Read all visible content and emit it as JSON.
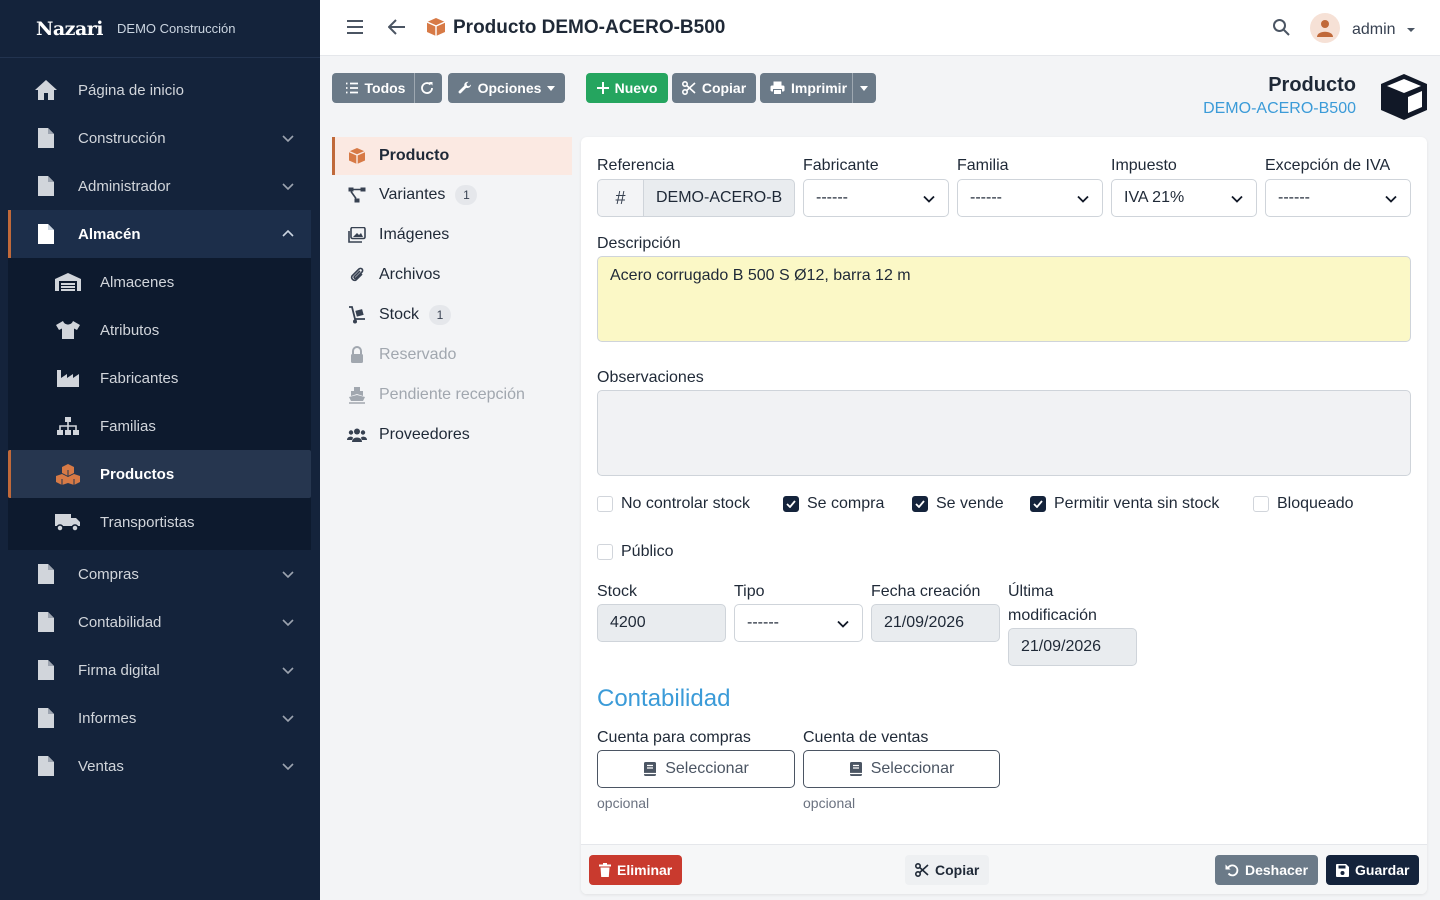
{
  "sidebar": {
    "brand": "Nazari",
    "company": "DEMO Construcción",
    "items": [
      {
        "label": "Página de inicio"
      },
      {
        "label": "Construcción"
      },
      {
        "label": "Administrador"
      },
      {
        "label": "Almacén"
      },
      {
        "label": "Compras"
      },
      {
        "label": "Contabilidad"
      },
      {
        "label": "Firma digital"
      },
      {
        "label": "Informes"
      },
      {
        "label": "Ventas"
      }
    ],
    "almacen_sub": [
      {
        "label": "Almacenes"
      },
      {
        "label": "Atributos"
      },
      {
        "label": "Fabricantes"
      },
      {
        "label": "Familias"
      },
      {
        "label": "Productos"
      },
      {
        "label": "Transportistas"
      }
    ]
  },
  "header": {
    "title": "Producto DEMO-ACERO-B500",
    "user": "admin"
  },
  "toolbar": {
    "todos": "Todos",
    "opciones": "Opciones",
    "nuevo": "Nuevo",
    "copiar": "Copiar",
    "imprimir": "Imprimir"
  },
  "entity": {
    "type": "Producto",
    "code": "DEMO-ACERO-B500"
  },
  "tabs": [
    {
      "label": "Producto"
    },
    {
      "label": "Variantes",
      "badge": "1"
    },
    {
      "label": "Imágenes"
    },
    {
      "label": "Archivos"
    },
    {
      "label": "Stock",
      "badge": "1"
    },
    {
      "label": "Reservado"
    },
    {
      "label": "Pendiente recepción"
    },
    {
      "label": "Proveedores"
    }
  ],
  "form": {
    "referencia_label": "Referencia",
    "referencia_prefix": "#",
    "referencia_value": "DEMO-ACERO-B",
    "fabricante_label": "Fabricante",
    "fabricante_value": "------",
    "familia_label": "Familia",
    "familia_value": "------",
    "impuesto_label": "Impuesto",
    "impuesto_value": "IVA 21%",
    "excepcion_label": "Excepción de IVA",
    "excepcion_value": "------",
    "descripcion_label": "Descripción",
    "descripcion_value": "Acero corrugado B 500 S Ø12, barra 12 m",
    "observaciones_label": "Observaciones",
    "observaciones_value": "",
    "checks": [
      {
        "label": "No controlar stock",
        "checked": false
      },
      {
        "label": "Se compra",
        "checked": true
      },
      {
        "label": "Se vende",
        "checked": true
      },
      {
        "label": "Permitir venta sin stock",
        "checked": true
      },
      {
        "label": "Bloqueado",
        "checked": false
      },
      {
        "label": "Público",
        "checked": false
      }
    ],
    "stock_label": "Stock",
    "stock_value": "4200",
    "tipo_label": "Tipo",
    "tipo_value": "------",
    "fecha_label": "Fecha creación",
    "fecha_value": "21/09/2026",
    "ultima_label_1": "Última",
    "ultima_label_2": "modificación",
    "ultima_value": "21/09/2026",
    "contabilidad_title": "Contabilidad",
    "cuenta_compras_label": "Cuenta para compras",
    "cuenta_ventas_label": "Cuenta de ventas",
    "seleccionar": "Seleccionar",
    "opcional": "opcional"
  },
  "footer": {
    "eliminar": "Eliminar",
    "copiar": "Copiar",
    "deshacer": "Deshacer",
    "guardar": "Guardar"
  },
  "colors": {
    "sidebar_bg": "#14233b",
    "accent": "#c0693a",
    "link": "#3b9bd8",
    "green": "#25a55f",
    "danger": "#c93a2e"
  }
}
